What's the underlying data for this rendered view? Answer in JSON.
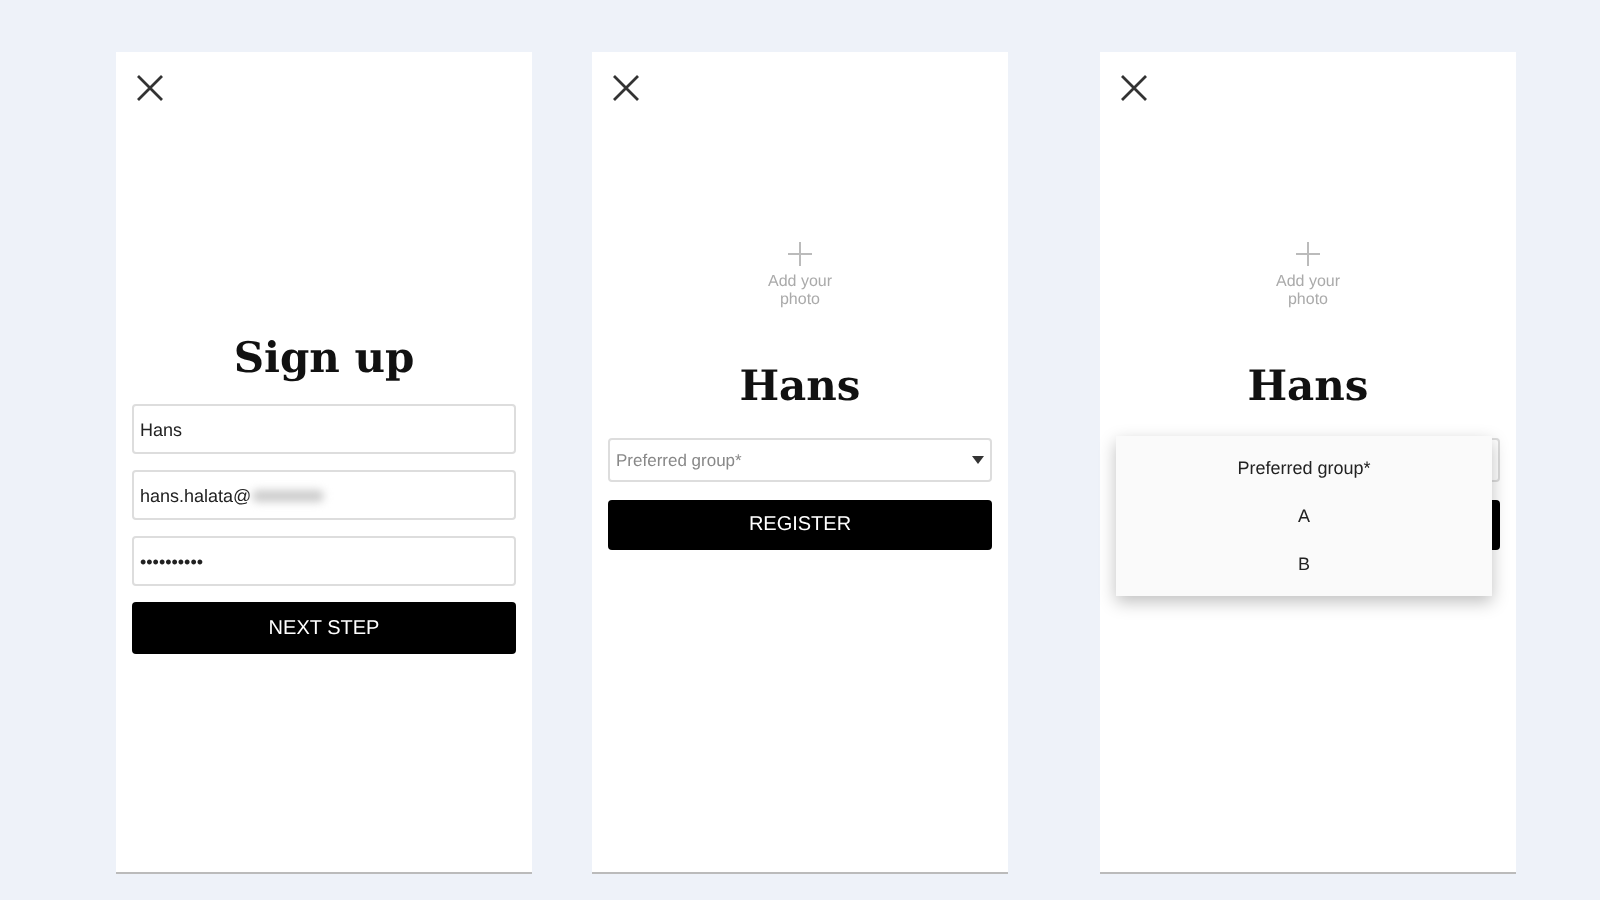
{
  "screens": [
    {
      "kind": "signup",
      "title": "Sign up",
      "fields": [
        {
          "value": "Hans",
          "blurred": false
        },
        {
          "value": "hans.halata@",
          "blurred": true
        },
        {
          "value": "••••••••••",
          "blurred": false
        }
      ],
      "button": "NEXT STEP"
    },
    {
      "kind": "profile",
      "photo_label": "Add your photo",
      "name": "Hans",
      "select": {
        "placeholder": "Preferred group*"
      },
      "button": "REGISTER"
    },
    {
      "kind": "profile_menu",
      "photo_label": "Add your photo",
      "name": "Hans",
      "menu": [
        {
          "label": "Preferred group*"
        },
        {
          "label": "A"
        },
        {
          "label": "B"
        }
      ]
    }
  ]
}
